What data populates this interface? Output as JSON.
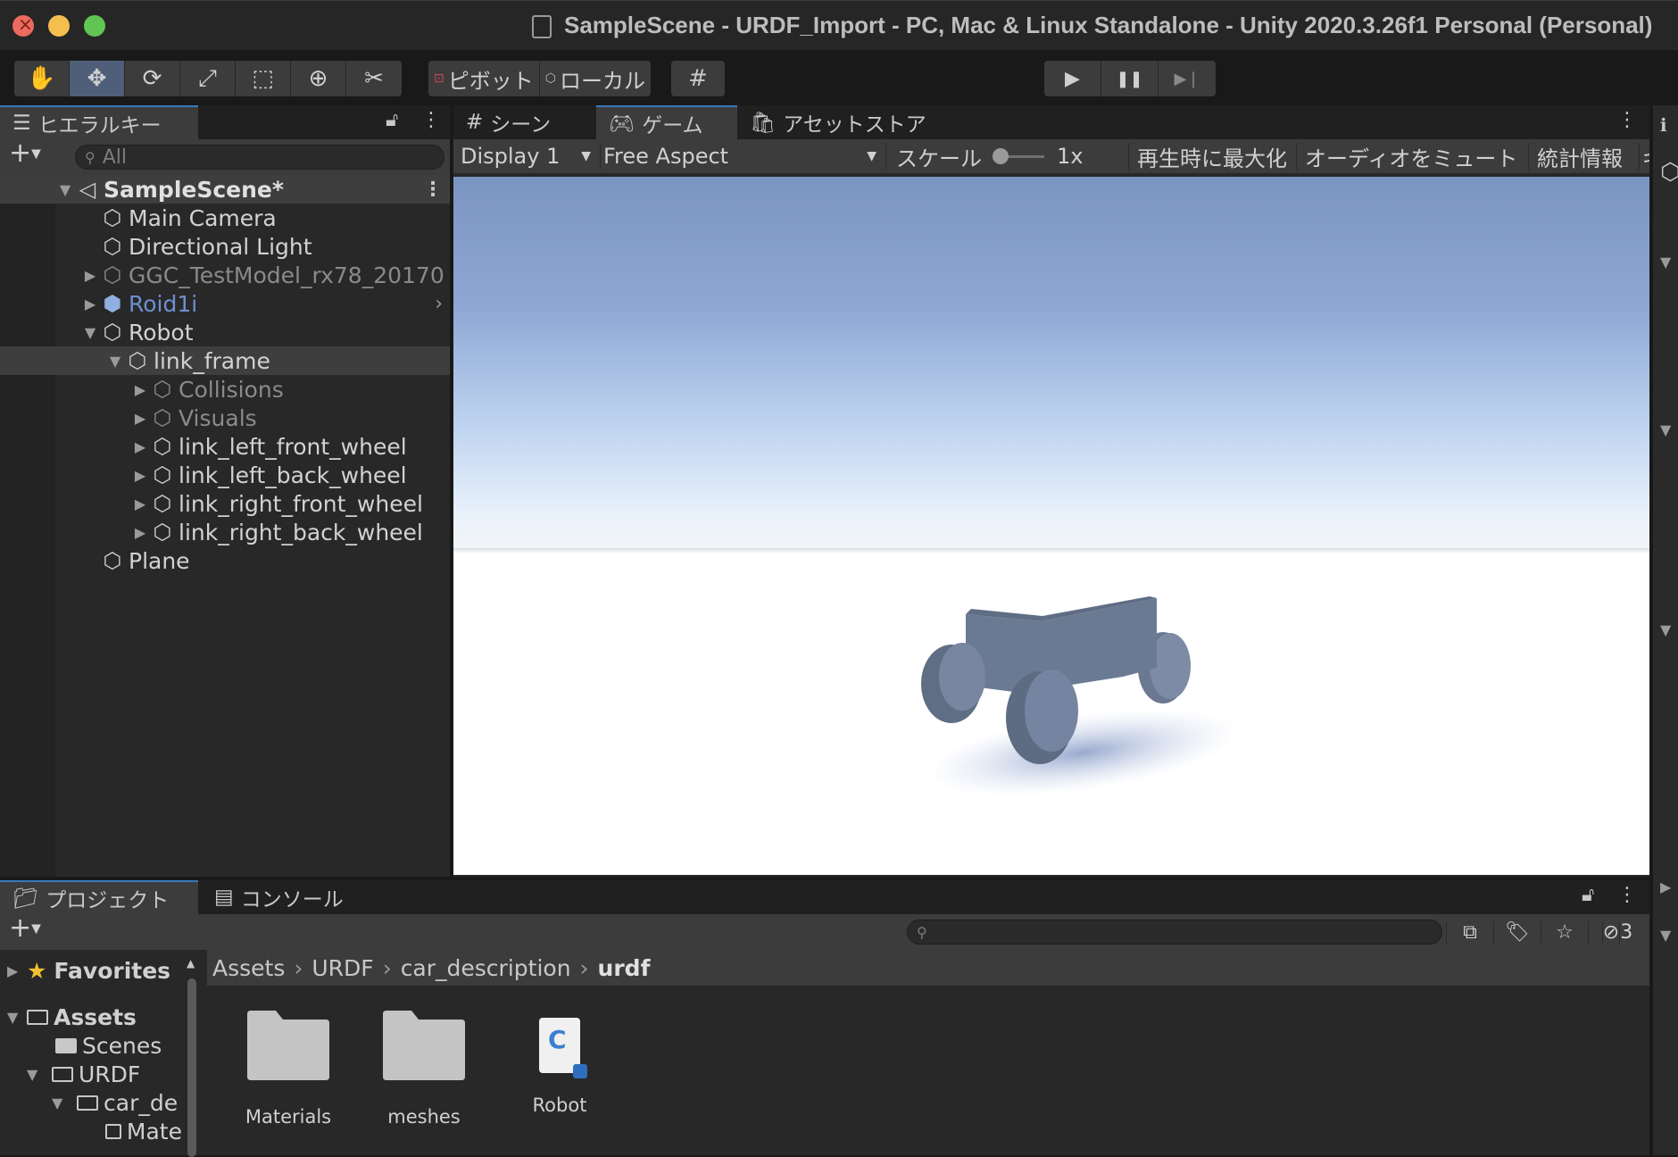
{
  "window": {
    "title": "SampleScene - URDF_Import - PC, Mac & Linux Standalone - Unity 2020.3.26f1 Personal (Personal)"
  },
  "toolbar": {
    "tools": [
      {
        "icon": "hand-tool-icon",
        "glyph": "✋"
      },
      {
        "icon": "move-tool-icon",
        "glyph": "✥"
      },
      {
        "icon": "rotate-tool-icon",
        "glyph": "⟳"
      },
      {
        "icon": "scale-tool-icon",
        "glyph": "⤢"
      },
      {
        "icon": "rect-tool-icon",
        "glyph": "⬚"
      },
      {
        "icon": "transform-tool-icon",
        "glyph": "⊕"
      },
      {
        "icon": "custom-tool-icon",
        "glyph": "✂"
      }
    ],
    "pivot_label": "ピボット",
    "local_label": "ローカル",
    "grid_snap_glyph": "#",
    "play_glyph": "▶",
    "pause_glyph": "❚❚",
    "step_glyph": "▶❘"
  },
  "hierarchy": {
    "tab_label": "ヒエラルキー",
    "search_placeholder": "All",
    "scene": "SampleScene*",
    "items": [
      {
        "label": "Main Camera",
        "depth": 1
      },
      {
        "label": "Directional Light",
        "depth": 1
      },
      {
        "label": "GGC_TestModel_rx78_20170",
        "depth": 1
      },
      {
        "label": "Roid1i",
        "depth": 1
      },
      {
        "label": "Robot",
        "depth": 1
      },
      {
        "label": "link_frame",
        "depth": 2
      },
      {
        "label": "Collisions",
        "depth": 3
      },
      {
        "label": "Visuals",
        "depth": 3
      },
      {
        "label": "link_left_front_wheel",
        "depth": 3
      },
      {
        "label": "link_left_back_wheel",
        "depth": 3
      },
      {
        "label": "link_right_front_wheel",
        "depth": 3
      },
      {
        "label": "link_right_back_wheel",
        "depth": 3
      },
      {
        "label": "Plane",
        "depth": 1
      }
    ]
  },
  "game_view": {
    "tabs": {
      "scene": "シーン",
      "game": "ゲーム",
      "asset_store": "アセットストア"
    },
    "display": "Display 1",
    "aspect": "Free Aspect",
    "scale_label": "スケール",
    "scale_value": "1x",
    "maximize_on_play": "再生時に最大化",
    "mute_audio": "オーディオをミュート",
    "stats": "統計情報",
    "gizmos": "ギ"
  },
  "project": {
    "tab_project": "プロジェクト",
    "tab_console": "コンソール",
    "hidden_count": "3",
    "favorites": "Favorites",
    "tree": [
      {
        "label": "Assets"
      },
      {
        "label": "Scenes"
      },
      {
        "label": "URDF"
      },
      {
        "label": "car_de"
      },
      {
        "label": "Mate"
      }
    ],
    "breadcrumb": [
      "Assets",
      "URDF",
      "car_description",
      "urdf"
    ],
    "assets": [
      {
        "name": "Materials",
        "type": "folder"
      },
      {
        "name": "meshes",
        "type": "folder"
      },
      {
        "name": "Robot",
        "type": "script"
      }
    ]
  },
  "colors": {
    "accent": "#3a79bb",
    "panel": "#282828",
    "toolbar": "#3c3c3c",
    "robot": "#6f7f99"
  }
}
